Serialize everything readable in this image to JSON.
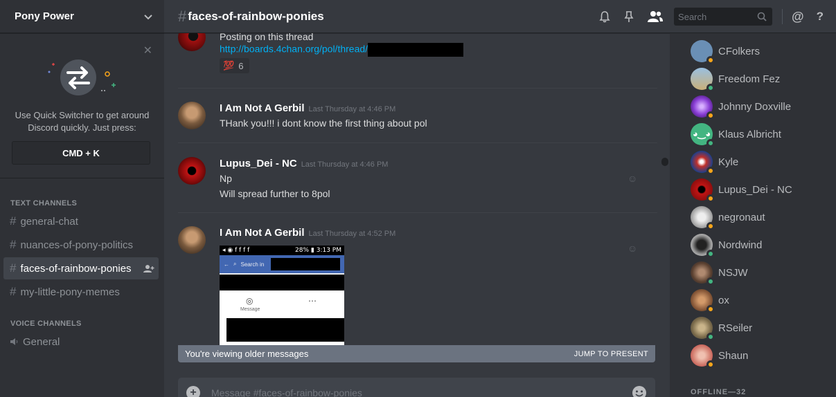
{
  "server": {
    "name": "Pony Power"
  },
  "quick_switcher": {
    "line1": "Use Quick Switcher to get around",
    "line2": "Discord quickly. Just press:",
    "shortcut": "CMD + K"
  },
  "channels": {
    "text_category": "TEXT CHANNELS",
    "text": [
      {
        "name": "general-chat",
        "active": false
      },
      {
        "name": "nuances-of-pony-politics",
        "active": false
      },
      {
        "name": "faces-of-rainbow-ponies",
        "active": true
      },
      {
        "name": "my-little-pony-memes",
        "active": false
      }
    ],
    "voice_category": "VOICE CHANNELS",
    "voice": [
      {
        "name": "General"
      }
    ]
  },
  "header": {
    "hash": "#",
    "channel": "faces-of-rainbow-ponies",
    "search_placeholder": "Search"
  },
  "messages": [
    {
      "line1": "Posting on this thread",
      "link": "http://boards.4chan.org/pol/thread/",
      "reaction_emoji": "💯",
      "reaction_count": "6"
    },
    {
      "author": "I Am Not A Gerbil",
      "timestamp": "Last Thursday at 4:46 PM",
      "lines": [
        "THank you!!! i dont know the first thing about pol"
      ]
    },
    {
      "author": "Lupus_Dei - NC",
      "timestamp": "Last Thursday at 4:46 PM",
      "lines": [
        "Np",
        "Will spread further to 8pol"
      ]
    },
    {
      "author": "I Am Not A Gerbil",
      "timestamp": "Last Thursday at 4:52 PM",
      "attachment": {
        "status_time": "3:13 PM",
        "status_battery": "28%",
        "search_text": "Search in",
        "message_label": "Message"
      }
    }
  ],
  "older_banner": {
    "text": "You're viewing older messages",
    "action": "JUMP TO PRESENT"
  },
  "composer": {
    "placeholder": "Message #faces-of-rainbow-ponies"
  },
  "members": [
    {
      "name": "CFolkers",
      "status": "idle",
      "color": "#6a8fb5"
    },
    {
      "name": "Freedom Fez",
      "status": "online",
      "color": "#8fb0d0"
    },
    {
      "name": "Johnny Doxville",
      "status": "idle",
      "color": "#8a3fd6"
    },
    {
      "name": "Klaus Albricht",
      "status": "online",
      "color": "#43b581"
    },
    {
      "name": "Kyle",
      "status": "idle",
      "color": "#3b5ea8"
    },
    {
      "name": "Lupus_Dei - NC",
      "status": "idle",
      "color": "#b01414"
    },
    {
      "name": "negronaut",
      "status": "idle",
      "color": "#c9c9c9"
    },
    {
      "name": "Nordwind",
      "status": "online",
      "color": "#7a7a7a"
    },
    {
      "name": "NSJW",
      "status": "online",
      "color": "#6b5546"
    },
    {
      "name": "ox",
      "status": "idle",
      "color": "#8a5a3a"
    },
    {
      "name": "RSeiler",
      "status": "online",
      "color": "#8c7a5a"
    },
    {
      "name": "Shaun",
      "status": "idle",
      "color": "#d8897a"
    }
  ],
  "offline_header": "OFFLINE—32",
  "colors": {
    "online": "#43b581",
    "idle": "#faa61a",
    "link": "#00b0f4"
  }
}
